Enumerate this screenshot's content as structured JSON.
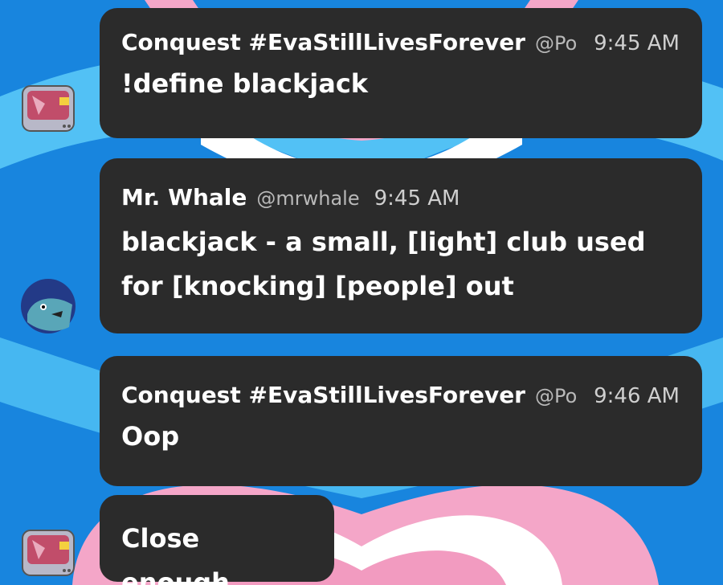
{
  "messages": [
    {
      "author": "Conquest #EvaStillLivesForever",
      "handle": "@Po",
      "time": "9:45 AM",
      "text": "!define blackjack"
    },
    {
      "author": "Mr. Whale",
      "handle": "@mrwhale",
      "time": "9:45 AM",
      "text": "blackjack - a small, [light] club used\nfor [knocking] [people] out"
    },
    {
      "author": "Conquest #EvaStillLivesForever",
      "handle": "@Po",
      "time": "9:46 AM",
      "text": "Oop"
    },
    {
      "text": "Close enough"
    }
  ],
  "avatars": {
    "conquest": "tv-monitor-icon",
    "whale": "whale-face-icon"
  },
  "colors": {
    "background_blue": "#1a8fe0",
    "pink": "#f4a6c8",
    "white": "#ffffff",
    "bubble": "#2b2b2b",
    "handle_gray": "#b9b9b9"
  }
}
